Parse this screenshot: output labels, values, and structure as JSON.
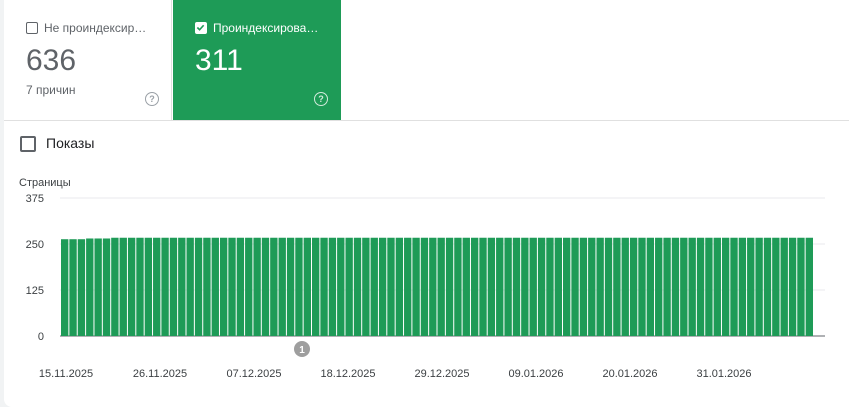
{
  "tiles": {
    "not_indexed": {
      "label": "Не проиндексир…",
      "value": "636",
      "sub": "7 причин",
      "checked": false
    },
    "indexed": {
      "label": "Проиндексирова…",
      "value": "311",
      "checked": true
    }
  },
  "shows": {
    "label": "Показы",
    "checked": false
  },
  "colors": {
    "accent": "#1e9b57",
    "bar": "#1e9b57",
    "annotation": "#9e9e9e"
  },
  "icons": {
    "help": "help-circle-icon",
    "check": "check-icon"
  },
  "help_glyph": "?",
  "chart_data": {
    "type": "bar",
    "ylabel": "Страницы",
    "ylim": [
      0,
      375
    ],
    "yticks": [
      "0",
      "125",
      "250",
      "375"
    ],
    "x_tick_labels": [
      "15.11.2025",
      "26.11.2025",
      "07.12.2025",
      "18.12.2025",
      "29.12.2025",
      "09.01.2026",
      "20.01.2026",
      "31.01.2026"
    ],
    "annotation": {
      "label": "1",
      "category_index": 30
    },
    "values": [
      263,
      263,
      263,
      265,
      265,
      265,
      267,
      267,
      267,
      267,
      267,
      267,
      267,
      267,
      267,
      267,
      267,
      267,
      267,
      267,
      267,
      267,
      267,
      267,
      267,
      267,
      267,
      267,
      267,
      267,
      267,
      267,
      267,
      267,
      267,
      267,
      267,
      267,
      267,
      267,
      267,
      267,
      267,
      267,
      267,
      267,
      267,
      267,
      267,
      267,
      267,
      267,
      267,
      267,
      267,
      267,
      267,
      267,
      267,
      267,
      267,
      267,
      267,
      267,
      267,
      267,
      267,
      267,
      267,
      267,
      267,
      267,
      267,
      267,
      267,
      267,
      267,
      267,
      267,
      267,
      267,
      267,
      267,
      267,
      267,
      267,
      267,
      267,
      267,
      267
    ],
    "series_note": ""
  }
}
